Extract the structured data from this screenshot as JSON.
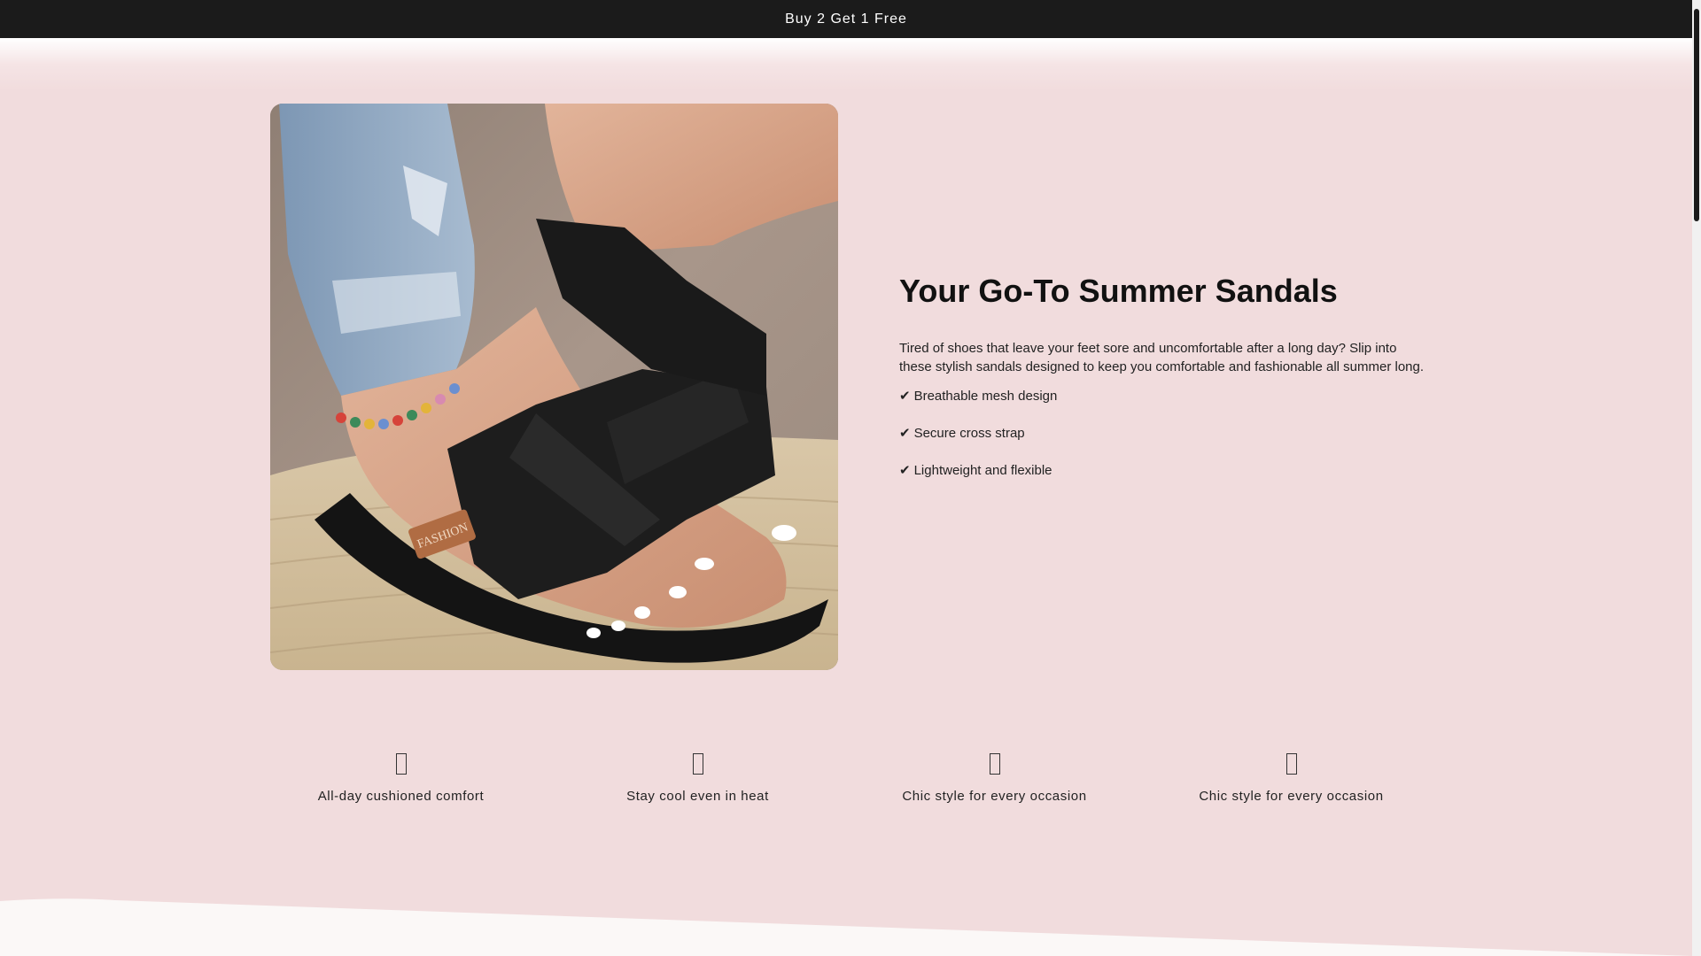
{
  "announcement": {
    "text": "Buy 2 Get 1 Free"
  },
  "hero": {
    "title": "Your Go-To Summer Sandals",
    "description": "Tired of shoes that leave your feet sore and uncomfortable after a long day? Slip into these stylish sandals designed to keep you comfortable and fashionable all summer long.",
    "bullets": [
      {
        "check": "✔",
        "text": "Breathable mesh design"
      },
      {
        "check": "✔",
        "text": "Secure cross strap"
      },
      {
        "check": "✔",
        "text": "Lightweight and flexible"
      }
    ],
    "image_badge": "FASHION"
  },
  "features": [
    {
      "icon": "placeholder-glyph-icon",
      "label": "All-day cushioned comfort"
    },
    {
      "icon": "placeholder-glyph-icon",
      "label": "Stay cool even in heat"
    },
    {
      "icon": "placeholder-glyph-icon",
      "label": "Chic style for every occasion"
    },
    {
      "icon": "placeholder-glyph-icon",
      "label": "Chic style for every occasion"
    }
  ],
  "colors": {
    "announcement_bg": "#1b1b1b",
    "page_bg": "#f1dcdd",
    "bottom_bg": "#fbf8f7"
  }
}
